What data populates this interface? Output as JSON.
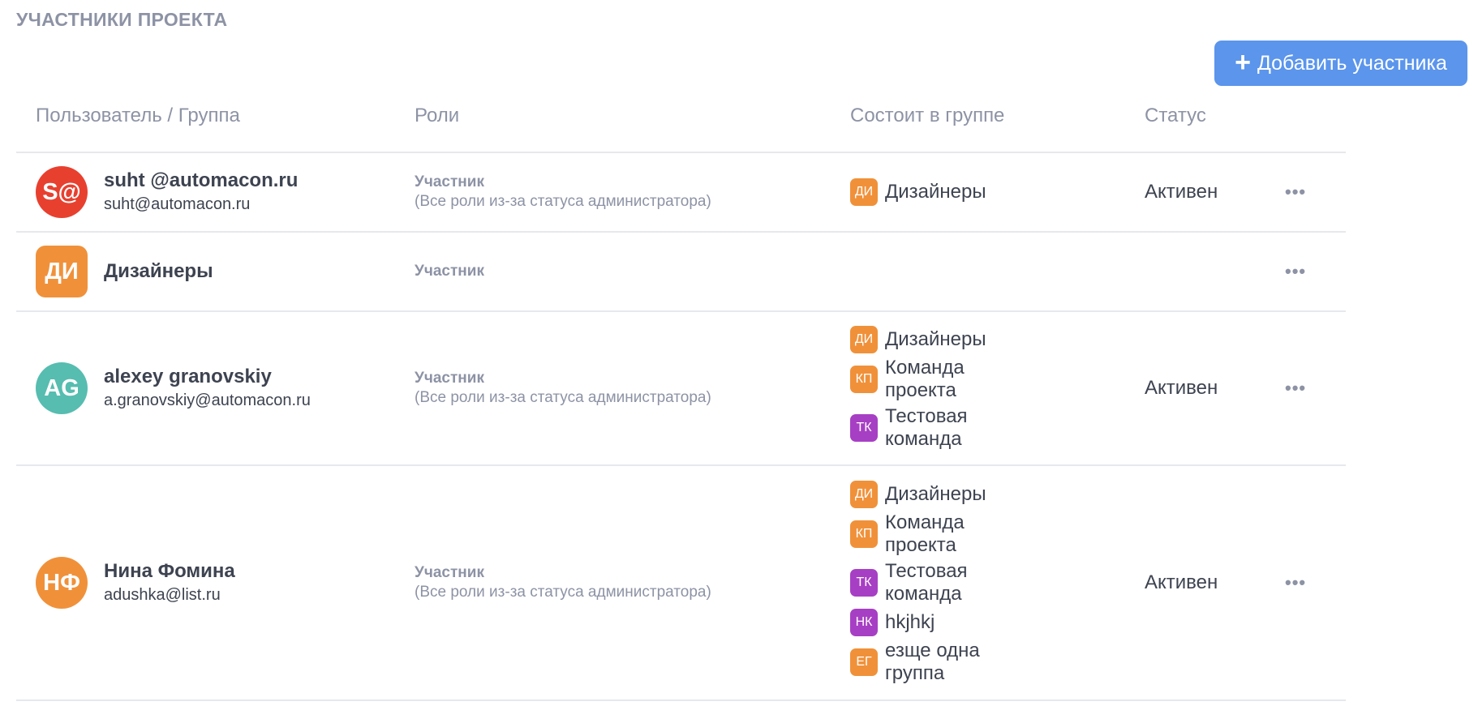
{
  "section_title": "УЧАСТНИКИ ПРОЕКТА",
  "add_button": {
    "icon": "plus-icon",
    "label": "Добавить участника",
    "color": "#5b95ec"
  },
  "columns": {
    "user": "Пользователь / Группа",
    "roles": "Роли",
    "groups": "Состоит в группе",
    "status": "Статус"
  },
  "more_icon": "•••",
  "rows": [
    {
      "avatar": {
        "initials": "S@",
        "color": "#e8402f",
        "shape": "round"
      },
      "name": "suht @automacon.ru",
      "email": "suht@automacon.ru",
      "role": "Участник",
      "role_note": "(Все роли из-за статуса администратора)",
      "groups": [
        {
          "initials": "ДИ",
          "name": "Дизайнеры",
          "color": "#f0913a"
        }
      ],
      "status": "Активен"
    },
    {
      "avatar": {
        "initials": "ДИ",
        "color": "#f0913a",
        "shape": "square"
      },
      "name": "Дизайнеры",
      "email": "",
      "role": "Участник",
      "role_note": "",
      "groups": [],
      "status": ""
    },
    {
      "avatar": {
        "initials": "AG",
        "color": "#56bdb0",
        "shape": "round"
      },
      "name": "alexey granovskiy",
      "email": "a.granovskiy@automacon.ru",
      "role": "Участник",
      "role_note": "(Все роли из-за статуса администратора)",
      "groups": [
        {
          "initials": "ДИ",
          "name": "Дизайнеры",
          "color": "#f0913a"
        },
        {
          "initials": "КП",
          "name": "Команда проекта",
          "color": "#f0913a"
        },
        {
          "initials": "ТК",
          "name": "Тестовая команда",
          "color": "#a73fc4"
        }
      ],
      "status": "Активен"
    },
    {
      "avatar": {
        "initials": "НФ",
        "color": "#f0913a",
        "shape": "round"
      },
      "name": "Нина Фомина",
      "email": "adushka@list.ru",
      "role": "Участник",
      "role_note": "(Все роли из-за статуса администратора)",
      "groups": [
        {
          "initials": "ДИ",
          "name": "Дизайнеры",
          "color": "#f0913a"
        },
        {
          "initials": "КП",
          "name": "Команда проекта",
          "color": "#f0913a"
        },
        {
          "initials": "ТК",
          "name": "Тестовая команда",
          "color": "#a73fc4"
        },
        {
          "initials": "НК",
          "name": "hkjhkj",
          "color": "#a73fc4"
        },
        {
          "initials": "ЕГ",
          "name": "езще одна группа",
          "color": "#f0913a"
        }
      ],
      "status": "Активен"
    }
  ]
}
